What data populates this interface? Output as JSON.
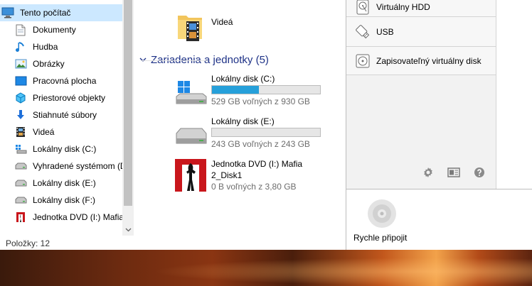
{
  "nav": {
    "items": [
      {
        "label": "Tento počítač",
        "icon": "computer-icon",
        "selected": true
      },
      {
        "label": "Dokumenty",
        "icon": "documents-icon"
      },
      {
        "label": "Hudba",
        "icon": "music-icon"
      },
      {
        "label": "Obrázky",
        "icon": "pictures-icon"
      },
      {
        "label": "Pracovná plocha",
        "icon": "desktop-icon"
      },
      {
        "label": "Priestorové objekty",
        "icon": "3d-objects-icon"
      },
      {
        "label": "Stiahnuté súbory",
        "icon": "downloads-icon"
      },
      {
        "label": "Videá",
        "icon": "videos-icon"
      },
      {
        "label": "Lokálny disk (C:)",
        "icon": "windows-drive-icon"
      },
      {
        "label": "Vyhradené systémom (D",
        "icon": "drive-icon"
      },
      {
        "label": "Lokálny disk (E:)",
        "icon": "drive-icon"
      },
      {
        "label": "Lokálny disk (F:)",
        "icon": "drive-icon"
      },
      {
        "label": "Jednotka DVD (I:) Mafia",
        "icon": "mafia-dvd-icon"
      }
    ]
  },
  "status": {
    "items_count": "Položky: 12"
  },
  "content": {
    "videos_folder": {
      "label": "Videá"
    },
    "group": {
      "title": "Zariadenia a jednotky (5)"
    },
    "drives": [
      {
        "name": "Lokálny disk (C:)",
        "space": "529 GB voľných z 930 GB",
        "used_fraction": 0.431
      },
      {
        "name": "Lokálny disk (E:)",
        "space": "243 GB voľných z 243 GB",
        "used_fraction": 0.0
      },
      {
        "name_line1": "Jednotka DVD (I:) Mafia",
        "name_line2": "2_Disk1",
        "space": "0 B voľných z 3,80 GB"
      }
    ]
  },
  "vpanel": {
    "items": [
      {
        "label": "Virtuálny HDD",
        "icon": "hdd-icon"
      },
      {
        "label": "USB",
        "icon": "usb-icon"
      },
      {
        "label": "Zapisovateľný virtuálny disk",
        "icon": "writable-disc-icon"
      }
    ],
    "tools": [
      "gear-icon",
      "image-catalog-icon",
      "help-icon"
    ]
  },
  "quickmount": {
    "label": "Rychle připojit"
  },
  "colors": {
    "selection": "#cce8ff",
    "group_header": "#1e3287",
    "drive_fill": "#26a0da"
  }
}
